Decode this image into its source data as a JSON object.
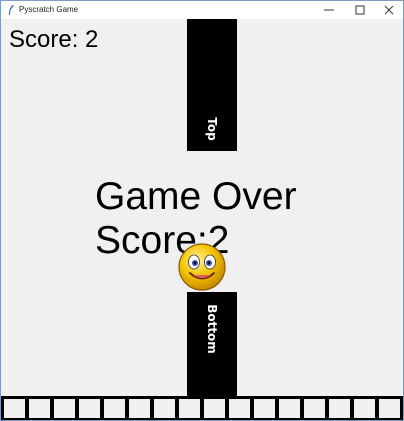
{
  "window": {
    "title": "Pyscratch Game",
    "icon": "feather-icon",
    "controls": [
      "minimize-icon",
      "maximize-icon",
      "close-icon"
    ]
  },
  "hud": {
    "score_text": "Score: 2"
  },
  "pipes": {
    "top_label": "Top",
    "bottom_label": "Bottom"
  },
  "game_over": {
    "line1": "Game Over",
    "line2": "Score:2"
  },
  "player": {
    "icon": "smiley-face-icon"
  },
  "ground": {
    "tile_count": 16
  },
  "colors": {
    "background": "#f0f0f0",
    "pipe": "#000000",
    "ground": "#000000",
    "smiley": "#f5c400"
  }
}
